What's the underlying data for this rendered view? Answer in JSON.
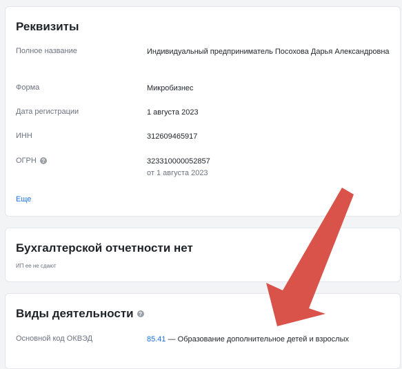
{
  "requisites": {
    "title": "Реквизиты",
    "rows": [
      {
        "label": "Полное название",
        "value": "Индивидуальный предприниматель Посохова Дарья Александровна"
      },
      {
        "label": "Форма",
        "value": "Микробизнес"
      },
      {
        "label": "Дата регистрации",
        "value": "1 августа 2023"
      },
      {
        "label": "ИНН",
        "value": "312609465917"
      },
      {
        "label": "ОГРН",
        "value": "323310000052857",
        "sub": "от 1 августа 2023"
      }
    ],
    "more_label": "Еще"
  },
  "accounting": {
    "title": "Бухгалтерской отчетности нет",
    "note": "ИП ее не сдают"
  },
  "activities": {
    "title": "Виды деятельности",
    "main_label": "Основной код ОКВЭД",
    "code": "85.41",
    "description": " — Образование дополнительное детей и взрослых"
  },
  "annotation": {
    "color": "#d9534a"
  }
}
